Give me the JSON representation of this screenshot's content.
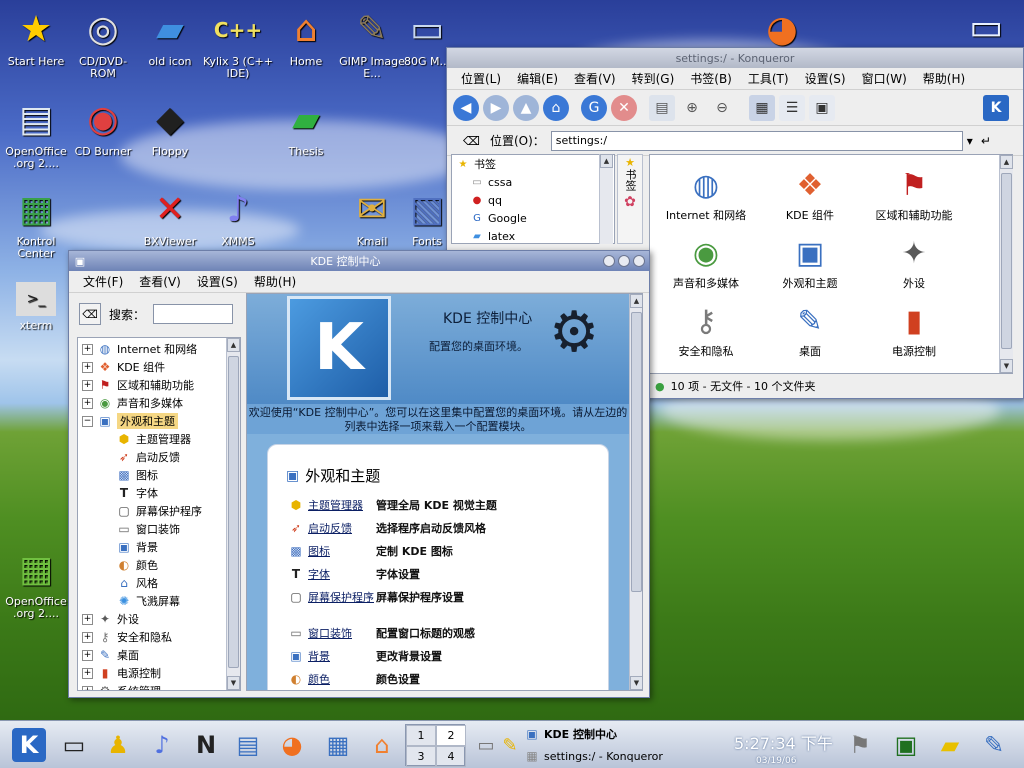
{
  "desktop": {
    "icons": [
      {
        "label": "Start Here",
        "icon": "star-icon"
      },
      {
        "label": "CD/DVD-ROM",
        "icon": "cdrom-icon"
      },
      {
        "label": "old icon",
        "icon": "folder-icon"
      },
      {
        "label": "Kylix 3 (C++ IDE)",
        "icon": "cpp-icon"
      },
      {
        "label": "Home",
        "icon": "home-icon"
      },
      {
        "label": "GIMP Image E...",
        "icon": "gimp-icon"
      },
      {
        "label": "80G M...",
        "icon": "usb-drive-icon"
      },
      {
        "label": "OpenOffice .org 2....",
        "icon": "openoffice-writer-icon"
      },
      {
        "label": "CD Burner",
        "icon": "cd-burner-icon"
      },
      {
        "label": "Floppy",
        "icon": "floppy-icon"
      },
      {
        "label": "Thesis",
        "icon": "folder-green-icon"
      },
      {
        "label": "Kontrol Center",
        "icon": "kontrol-center-icon"
      },
      {
        "label": "BXViewer",
        "icon": "bxviewer-icon"
      },
      {
        "label": "XMMS",
        "icon": "music-note-icon"
      },
      {
        "label": "Kmail",
        "icon": "kmail-icon"
      },
      {
        "label": "Fonts",
        "icon": "fonts-icon"
      },
      {
        "label": "xterm",
        "icon": "terminal-icon"
      },
      {
        "label": "OpenOffice .org 2....",
        "icon": "openoffice-calc-icon"
      }
    ]
  },
  "konqueror": {
    "title": "settings:/ - Konqueror",
    "menu": [
      "位置(L)",
      "编辑(E)",
      "查看(V)",
      "转到(G)",
      "书签(B)",
      "工具(T)",
      "设置(S)",
      "窗口(W)",
      "帮助(H)"
    ],
    "location_label": "位置(O)：",
    "location_value": "settings:/",
    "bookmarks_header": "书签",
    "bookmarks": [
      "cssa",
      "qq",
      "Google",
      "latex"
    ],
    "side_tab": "书签",
    "grid": [
      {
        "label": "Internet 和网络",
        "icon": "globe-icon"
      },
      {
        "label": "KDE 组件",
        "icon": "cubes-icon"
      },
      {
        "label": "区域和辅助功能",
        "icon": "flags-icon"
      },
      {
        "label": "声音和多媒体",
        "icon": "speaker-icon"
      },
      {
        "label": "外观和主题",
        "icon": "brush-icon"
      },
      {
        "label": "外设",
        "icon": "peripherals-icon"
      },
      {
        "label": "安全和隐私",
        "icon": "keys-icon"
      },
      {
        "label": "桌面",
        "icon": "desktop-pen-icon"
      },
      {
        "label": "电源控制",
        "icon": "battery-icon"
      }
    ],
    "status": "10 项 - 无文件 - 10 个文件夹"
  },
  "kcc": {
    "title": "KDE 控制中心",
    "menu": [
      "文件(F)",
      "查看(V)",
      "设置(S)",
      "帮助(H)"
    ],
    "search_label": "搜索：",
    "search_value": "",
    "tree": [
      {
        "label": "Internet 和网络",
        "icon": "globe-icon",
        "exp": "+",
        "child": false,
        "sel": false
      },
      {
        "label": "KDE 组件",
        "icon": "cubes-icon",
        "exp": "+",
        "child": false,
        "sel": false
      },
      {
        "label": "区域和辅助功能",
        "icon": "flags-icon",
        "exp": "+",
        "child": false,
        "sel": false
      },
      {
        "label": "声音和多媒体",
        "icon": "speaker-icon",
        "exp": "+",
        "child": false,
        "sel": false
      },
      {
        "label": "外观和主题",
        "icon": "brush-icon",
        "exp": "−",
        "child": false,
        "sel": true
      },
      {
        "label": "主题管理器",
        "icon": "theme-manager-icon",
        "exp": "",
        "child": true,
        "sel": false
      },
      {
        "label": "启动反馈",
        "icon": "rocket-icon",
        "exp": "",
        "child": true,
        "sel": false
      },
      {
        "label": "图标",
        "icon": "icons-icon",
        "exp": "",
        "child": true,
        "sel": false
      },
      {
        "label": "字体",
        "icon": "font-icon",
        "exp": "",
        "child": true,
        "sel": false
      },
      {
        "label": "屏幕保护程序",
        "icon": "screensaver-icon",
        "exp": "",
        "child": true,
        "sel": false
      },
      {
        "label": "窗口装饰",
        "icon": "window-deco-icon",
        "exp": "",
        "child": true,
        "sel": false
      },
      {
        "label": "背景",
        "icon": "background-icon",
        "exp": "",
        "child": true,
        "sel": false
      },
      {
        "label": "颜色",
        "icon": "colors-icon",
        "exp": "",
        "child": true,
        "sel": false
      },
      {
        "label": "风格",
        "icon": "style-icon",
        "exp": "",
        "child": true,
        "sel": false
      },
      {
        "label": "飞溅屏幕",
        "icon": "splash-icon",
        "exp": "",
        "child": true,
        "sel": false
      },
      {
        "label": "外设",
        "icon": "peripherals-icon",
        "exp": "+",
        "child": false,
        "sel": false
      },
      {
        "label": "安全和隐私",
        "icon": "keys-icon",
        "exp": "+",
        "child": false,
        "sel": false
      },
      {
        "label": "桌面",
        "icon": "desktop-pen-icon",
        "exp": "+",
        "child": false,
        "sel": false
      },
      {
        "label": "电源控制",
        "icon": "battery-icon",
        "exp": "+",
        "child": false,
        "sel": false
      },
      {
        "label": "系统管理",
        "icon": "system-admin-icon",
        "exp": "+",
        "child": false,
        "sel": false
      }
    ],
    "banner_title": "KDE 控制中心",
    "banner_subtitle": "配置您的桌面环境。",
    "welcome": "欢迎使用“KDE 控制中心”。您可以在这里集中配置您的桌面环境。请从左边的列表中选择一项来载入一个配置模块。",
    "section_title": "外观和主题",
    "modules": [
      {
        "name": "主题管理器",
        "desc": "管理全局 KDE 视觉主题",
        "icon": "theme-manager-icon"
      },
      {
        "name": "启动反馈",
        "desc": "选择程序启动反馈风格",
        "icon": "rocket-icon"
      },
      {
        "name": "图标",
        "desc": "定制 KDE 图标",
        "icon": "icons-icon"
      },
      {
        "name": "字体",
        "desc": "字体设置",
        "icon": "font-icon"
      },
      {
        "name": "屏幕保护程序",
        "desc": "屏幕保护程序设置",
        "icon": "screensaver-icon"
      },
      {
        "name": "窗口装饰",
        "desc": "配置窗口标题的观感",
        "icon": "window-deco-icon"
      },
      {
        "name": "背景",
        "desc": "更改背景设置",
        "icon": "background-icon"
      },
      {
        "name": "颜色",
        "desc": "颜色设置",
        "icon": "colors-icon"
      }
    ]
  },
  "taskbar": {
    "pager": [
      "1",
      "2",
      "3",
      "4"
    ],
    "active_desktop": "2",
    "tasks": [
      {
        "label": "KDE 控制中心",
        "icon": "kcc-task-icon"
      },
      {
        "label": "settings:/ - Konqueror",
        "icon": "konqueror-task-icon"
      }
    ],
    "clock_time": "5:27:34 下午",
    "clock_date": "03/19/06"
  }
}
